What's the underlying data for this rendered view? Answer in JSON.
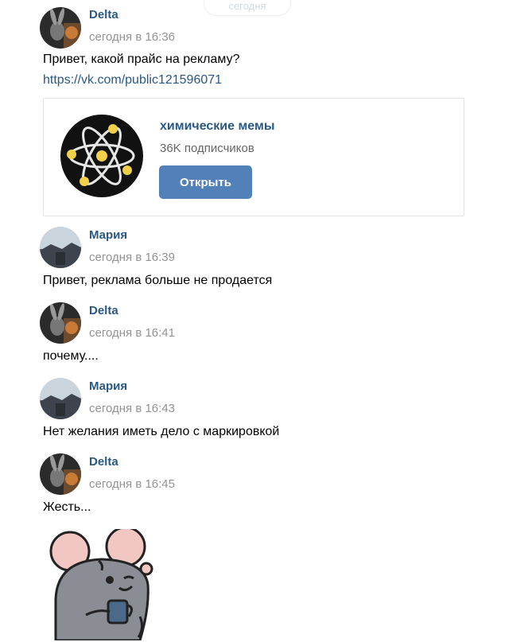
{
  "date_pill": "сегодня",
  "messages": [
    {
      "author": "Delta",
      "time": "сегодня в 16:36",
      "text": "Привет, какой прайс на рекламу?",
      "link": "https://vk.com/public121596071"
    },
    {
      "author": "Мария",
      "time": "сегодня в 16:39",
      "text": "Привет, реклама больше не продается"
    },
    {
      "author": "Delta",
      "time": "сегодня в 16:41",
      "text": "почему...."
    },
    {
      "author": "Мария",
      "time": "сегодня в 16:43",
      "text": "Нет желания иметь дело с маркировкой"
    },
    {
      "author": "Delta",
      "time": "сегодня в 16:45",
      "text": "Жесть..."
    }
  ],
  "link_card": {
    "name": "химические мемы",
    "subscribers": "36K подписчиков",
    "button": "Открыть"
  },
  "colors": {
    "author": "#2a5885",
    "button": "#5181b8",
    "muted": "#939393"
  },
  "icons": {
    "delta_avatar": "rabbit-avatar-icon",
    "maria_avatar": "landscape-avatar-icon",
    "group_logo": "atom-logo-icon",
    "sticker": "mouse-sticker-icon"
  }
}
